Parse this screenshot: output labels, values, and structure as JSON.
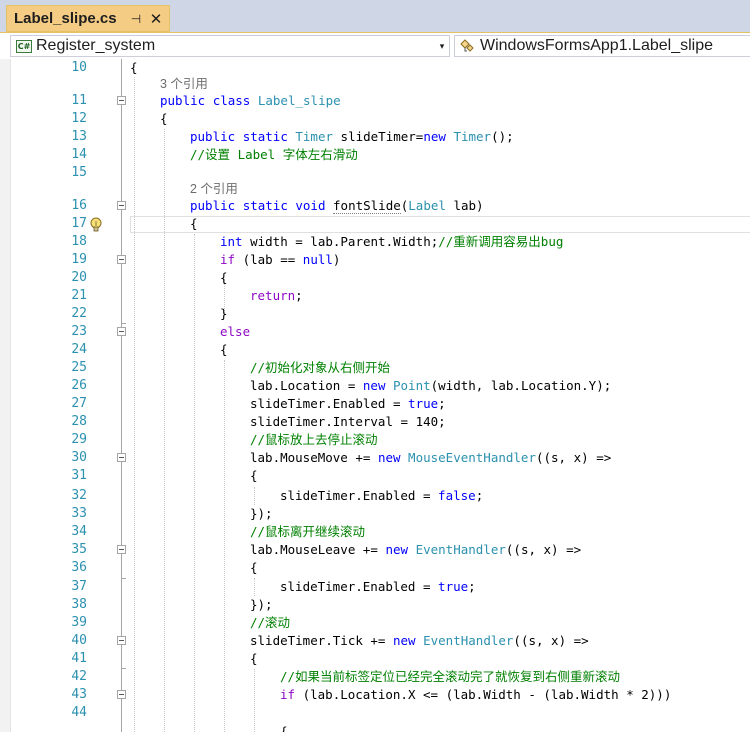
{
  "tab": {
    "title": "Label_slipe.cs",
    "pin": "⊣",
    "close": "✕"
  },
  "nav": {
    "project_combo": "Register_system",
    "project_icon": "C#",
    "class_combo": "WindowsFormsApp1.Label_slipe",
    "arrow": "▾"
  },
  "lens": {
    "line11": "3 个引用",
    "line16": "2 个引用"
  },
  "lines": [
    {
      "n": "10",
      "tokens": [
        [
          "pl",
          "{"
        ]
      ]
    },
    {
      "n": "11",
      "tokens": [
        [
          "kw",
          "public"
        ],
        [
          "pl",
          " "
        ],
        [
          "kw",
          "class"
        ],
        [
          "pl",
          " "
        ],
        [
          "ty",
          "Label_slipe"
        ]
      ]
    },
    {
      "n": "12",
      "tokens": [
        [
          "pl",
          "{"
        ]
      ]
    },
    {
      "n": "13",
      "tokens": [
        [
          "kw",
          "public"
        ],
        [
          "pl",
          " "
        ],
        [
          "kw",
          "static"
        ],
        [
          "pl",
          " "
        ],
        [
          "ty",
          "Timer"
        ],
        [
          "pl",
          " slideTimer="
        ],
        [
          "kw",
          "new"
        ],
        [
          "pl",
          " "
        ],
        [
          "ty",
          "Timer"
        ],
        [
          "pl",
          "();"
        ]
      ]
    },
    {
      "n": "14",
      "tokens": [
        [
          "cm",
          "//设置 Label 字体左右滑动"
        ]
      ]
    },
    {
      "n": "15",
      "tokens": []
    },
    {
      "n": "16",
      "tokens": [
        [
          "kw",
          "public"
        ],
        [
          "pl",
          " "
        ],
        [
          "kw",
          "static"
        ],
        [
          "pl",
          " "
        ],
        [
          "kw",
          "void"
        ],
        [
          "pl",
          " "
        ],
        [
          "sq",
          "fontSlide"
        ],
        [
          "pl",
          "("
        ],
        [
          "ty",
          "Label"
        ],
        [
          "pl",
          " lab)"
        ]
      ]
    },
    {
      "n": "17",
      "tokens": [
        [
          "pl",
          "{"
        ]
      ]
    },
    {
      "n": "18",
      "tokens": [
        [
          "kw",
          "int"
        ],
        [
          "pl",
          " width = lab.Parent.Width;"
        ],
        [
          "cm",
          "//重新调用容易出bug"
        ]
      ]
    },
    {
      "n": "19",
      "tokens": [
        [
          "ct",
          "if"
        ],
        [
          "pl",
          " (lab == "
        ],
        [
          "kw",
          "null"
        ],
        [
          "pl",
          ")"
        ]
      ]
    },
    {
      "n": "20",
      "tokens": [
        [
          "pl",
          "{"
        ]
      ]
    },
    {
      "n": "21",
      "tokens": [
        [
          "ct",
          "return"
        ],
        [
          "pl",
          ";"
        ]
      ]
    },
    {
      "n": "22",
      "tokens": [
        [
          "pl",
          "}"
        ]
      ]
    },
    {
      "n": "23",
      "tokens": [
        [
          "ct",
          "else"
        ]
      ]
    },
    {
      "n": "24",
      "tokens": [
        [
          "pl",
          "{"
        ]
      ]
    },
    {
      "n": "25",
      "tokens": [
        [
          "cm",
          "//初始化对象从右侧开始"
        ]
      ]
    },
    {
      "n": "26",
      "tokens": [
        [
          "pl",
          "lab.Location = "
        ],
        [
          "kw",
          "new"
        ],
        [
          "pl",
          " "
        ],
        [
          "ty",
          "Point"
        ],
        [
          "pl",
          "(width, lab.Location.Y);"
        ]
      ]
    },
    {
      "n": "27",
      "tokens": [
        [
          "pl",
          "slideTimer.Enabled = "
        ],
        [
          "kw",
          "true"
        ],
        [
          "pl",
          ";"
        ]
      ]
    },
    {
      "n": "28",
      "tokens": [
        [
          "pl",
          "slideTimer.Interval = 140;"
        ]
      ]
    },
    {
      "n": "29",
      "tokens": [
        [
          "cm",
          "//鼠标放上去停止滚动"
        ]
      ]
    },
    {
      "n": "30",
      "tokens": [
        [
          "pl",
          "lab.MouseMove += "
        ],
        [
          "kw",
          "new"
        ],
        [
          "pl",
          " "
        ],
        [
          "ty",
          "MouseEventHandler"
        ],
        [
          "pl",
          "((s, x) =>"
        ]
      ]
    },
    {
      "n": "31",
      "tokens": [
        [
          "pl",
          "{"
        ]
      ]
    },
    {
      "n": "32",
      "tokens": [
        [
          "pl",
          "slideTimer.Enabled = "
        ],
        [
          "kw",
          "false"
        ],
        [
          "pl",
          ";"
        ]
      ]
    },
    {
      "n": "33",
      "tokens": [
        [
          "pl",
          "});"
        ]
      ]
    },
    {
      "n": "34",
      "tokens": [
        [
          "cm",
          "//鼠标离开继续滚动"
        ]
      ]
    },
    {
      "n": "35",
      "tokens": [
        [
          "pl",
          "lab.MouseLeave += "
        ],
        [
          "kw",
          "new"
        ],
        [
          "pl",
          " "
        ],
        [
          "ty",
          "EventHandler"
        ],
        [
          "pl",
          "((s, x) =>"
        ]
      ]
    },
    {
      "n": "36",
      "tokens": [
        [
          "pl",
          "{"
        ]
      ]
    },
    {
      "n": "37",
      "tokens": [
        [
          "pl",
          "slideTimer.Enabled = "
        ],
        [
          "kw",
          "true"
        ],
        [
          "pl",
          ";"
        ]
      ]
    },
    {
      "n": "38",
      "tokens": [
        [
          "pl",
          "});"
        ]
      ]
    },
    {
      "n": "39",
      "tokens": [
        [
          "cm",
          "//滚动"
        ]
      ]
    },
    {
      "n": "40",
      "tokens": [
        [
          "pl",
          "slideTimer.Tick += "
        ],
        [
          "kw",
          "new"
        ],
        [
          "pl",
          " "
        ],
        [
          "ty",
          "EventHandler"
        ],
        [
          "pl",
          "((s, x) =>"
        ]
      ]
    },
    {
      "n": "41",
      "tokens": [
        [
          "pl",
          "{"
        ]
      ]
    },
    {
      "n": "42",
      "tokens": [
        [
          "cm",
          "//如果当前标签定位已经完全滚动完了就恢复到右侧重新滚动"
        ]
      ]
    },
    {
      "n": "43",
      "tokens": [
        [
          "ct",
          "if"
        ],
        [
          "pl",
          " (lab.Location.X <= (lab.Width - (lab.Width * 2)))"
        ]
      ]
    },
    {
      "n": "44",
      "tokens": []
    },
    {
      "n": "",
      "tokens": [
        [
          "pl",
          "{"
        ]
      ]
    }
  ],
  "colors": {
    "keyword": "#0000ff",
    "type": "#2b91af",
    "comment": "#008000",
    "control": "#8f08c4",
    "line_number": "#2b91af",
    "tab_active": "#f5cc84"
  }
}
